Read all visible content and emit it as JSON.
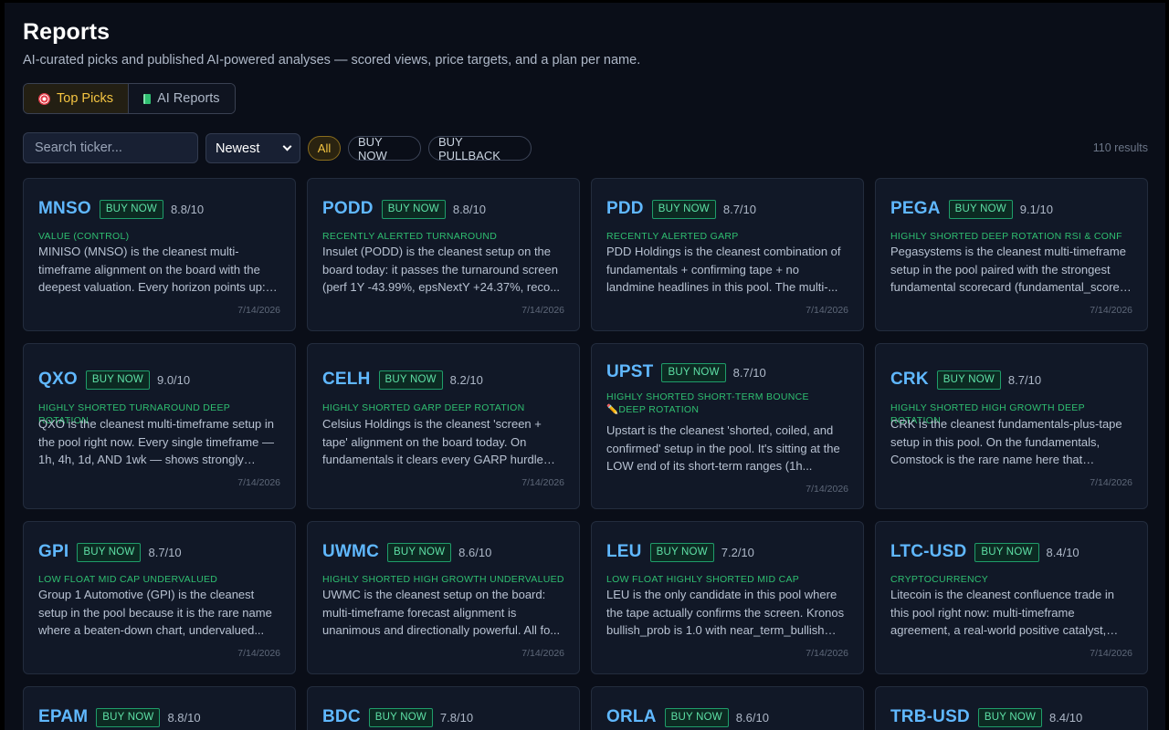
{
  "header": {
    "title": "Reports",
    "subtitle": "AI-curated picks and published AI-powered analyses — scored views, price targets, and a plan per name."
  },
  "tabs": [
    {
      "label": "Top Picks",
      "icon": "target-icon",
      "active": true
    },
    {
      "label": "AI Reports",
      "icon": "book-icon",
      "active": false
    }
  ],
  "controls": {
    "search_placeholder": "Search ticker...",
    "sort_value": "Newest",
    "filters": [
      "All",
      "BUY NOW",
      "BUY PULLBACK"
    ],
    "active_filter": "All",
    "results": "110 results"
  },
  "colors": {
    "background": "#0a0e18",
    "card": "#111827",
    "ticker": "#60b8ff",
    "tag": "#2fbf71",
    "accent": "#f5c542"
  },
  "cards": [
    {
      "ticker": "MNSO",
      "badge": "BUY NOW",
      "score": "8.8/10",
      "tag": "VALUE (CONTROL)",
      "summary": "MINISO (MNSO) is the cleanest multi-timeframe alignment on the board with the deepest valuation. Every horizon points up: 1...",
      "date": "7/14/2026"
    },
    {
      "ticker": "PODD",
      "badge": "BUY NOW",
      "score": "8.8/10",
      "tag": "RECENTLY ALERTED TURNAROUND",
      "summary": "Insulet (PODD) is the cleanest setup on the board today: it passes the turnaround screen (perf 1Y -43.99%, epsNextY +24.37%, reco...",
      "date": "7/14/2026"
    },
    {
      "ticker": "PDD",
      "badge": "BUY NOW",
      "score": "8.7/10",
      "tag": "RECENTLY ALERTED GARP",
      "summary": "PDD Holdings is the cleanest combination of fundamentals + confirming tape + no landmine headlines in this pool. The multi-...",
      "date": "7/14/2026"
    },
    {
      "ticker": "PEGA",
      "badge": "BUY NOW",
      "score": "9.1/10",
      "tag": "HIGHLY SHORTED DEEP ROTATION RSI & CONF",
      "summary": "Pegasystems is the cleanest multi-timeframe setup in the pool paired with the strongest fundamental scorecard (fundamental_score ...",
      "date": "7/14/2026"
    },
    {
      "ticker": "QXO",
      "badge": "BUY NOW",
      "score": "9.0/10",
      "tag": "HIGHLY SHORTED TURNAROUND DEEP ROTATION",
      "summary": "QXO is the cleanest multi-timeframe setup in the pool right now. Every single timeframe — 1h, 4h, 1d, AND 1wk — shows strongly positi...",
      "date": "7/14/2026"
    },
    {
      "ticker": "CELH",
      "badge": "BUY NOW",
      "score": "8.2/10",
      "tag": "HIGHLY SHORTED GARP DEEP ROTATION",
      "summary": "Celsius Holdings is the cleanest 'screen + tape' alignment on the board today. On fundamentals it clears every GARP hurdle wi...",
      "date": "7/14/2026"
    },
    {
      "ticker": "UPST",
      "badge": "BUY NOW",
      "score": "8.7/10",
      "tag": "HIGHLY SHORTED SHORT-TERM BOUNCE ✏️DEEP ROTATION",
      "summary": "Upstart is the cleanest 'shorted, coiled, and confirmed' setup in the pool. It's sitting at the LOW end of its short-term ranges (1h...",
      "date": "7/14/2026"
    },
    {
      "ticker": "CRK",
      "badge": "BUY NOW",
      "score": "8.7/10",
      "tag": "HIGHLY SHORTED HIGH GROWTH DEEP ROTATION",
      "summary": "CRK is the cleanest fundamentals-plus-tape setup in this pool. On the fundamentals, Comstock is the rare name here that already...",
      "date": "7/14/2026"
    },
    {
      "ticker": "GPI",
      "badge": "BUY NOW",
      "score": "8.7/10",
      "tag": "LOW FLOAT MID CAP UNDERVALUED",
      "summary": "Group 1 Automotive (GPI) is the cleanest setup in the pool because it is the rare name where a beaten-down chart, undervalued...",
      "date": "7/14/2026"
    },
    {
      "ticker": "UWMC",
      "badge": "BUY NOW",
      "score": "8.6/10",
      "tag": "HIGHLY SHORTED HIGH GROWTH UNDERVALUED",
      "summary": "UWMC is the cleanest setup on the board: multi-timeframe forecast alignment is unanimous and directionally powerful. All fo...",
      "date": "7/14/2026"
    },
    {
      "ticker": "LEU",
      "badge": "BUY NOW",
      "score": "7.2/10",
      "tag": "LOW FLOAT HIGHLY SHORTED MID CAP",
      "summary": "LEU is the only candidate in this pool where the tape actually confirms the screen. Kronos bullish_prob is 1.0 with near_term_bullish 0.6,...",
      "date": "7/14/2026"
    },
    {
      "ticker": "LTC-USD",
      "badge": "BUY NOW",
      "score": "8.4/10",
      "tag": "CRYPTOCURRENCY",
      "summary": "Litecoin is the cleanest confluence trade in this pool right now: multi-timeframe agreement, a real-world positive catalyst, an...",
      "date": "7/14/2026"
    },
    {
      "ticker": "EPAM",
      "badge": "BUY NOW",
      "score": "8.8/10",
      "tag": "",
      "summary": "",
      "date": ""
    },
    {
      "ticker": "BDC",
      "badge": "BUY NOW",
      "score": "7.8/10",
      "tag": "",
      "summary": "",
      "date": ""
    },
    {
      "ticker": "ORLA",
      "badge": "BUY NOW",
      "score": "8.6/10",
      "tag": "",
      "summary": "",
      "date": ""
    },
    {
      "ticker": "TRB-USD",
      "badge": "BUY NOW",
      "score": "8.4/10",
      "tag": "",
      "summary": "",
      "date": ""
    }
  ]
}
